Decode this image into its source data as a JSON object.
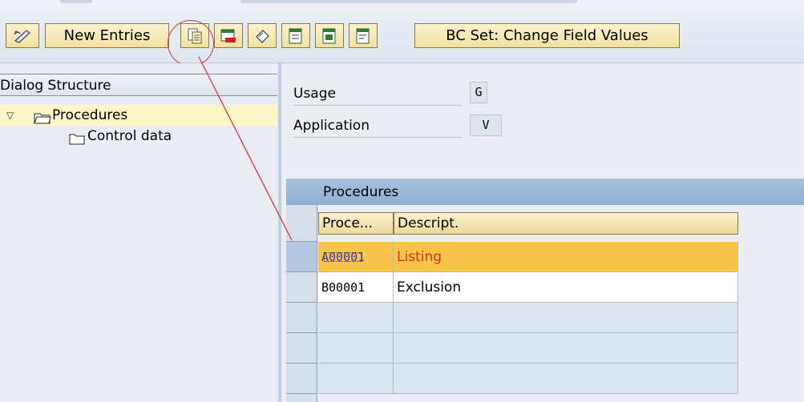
{
  "toolbar": {
    "new_entries_label": "New Entries",
    "bc_set_label": "BC Set: Change Field Values",
    "icons": [
      "change-display-icon",
      "copy-icon",
      "delete-icon",
      "undo-icon",
      "select-all-icon",
      "select-block-icon",
      "deselect-all-icon"
    ]
  },
  "dialog_structure": {
    "title": "Dialog Structure",
    "items": [
      {
        "label": "Procedures",
        "expanded": true,
        "selected": true
      },
      {
        "label": "Control data"
      }
    ]
  },
  "fields": [
    {
      "label": "Usage",
      "value": "G"
    },
    {
      "label": "Application",
      "value": "V"
    }
  ],
  "table": {
    "title": "Procedures",
    "columns": [
      "Proce...",
      "Descript."
    ],
    "rows": [
      {
        "code": "A00001",
        "description": "Listing",
        "selected": true
      },
      {
        "code": "B00001",
        "description": "Exclusion"
      }
    ],
    "empty_rows": 3
  },
  "colors": {
    "toolbar_button": "#f2e1a1",
    "selected_row": "#f8c54a",
    "table_title": "#8fadd1",
    "annotation_red": "#d1363b"
  }
}
